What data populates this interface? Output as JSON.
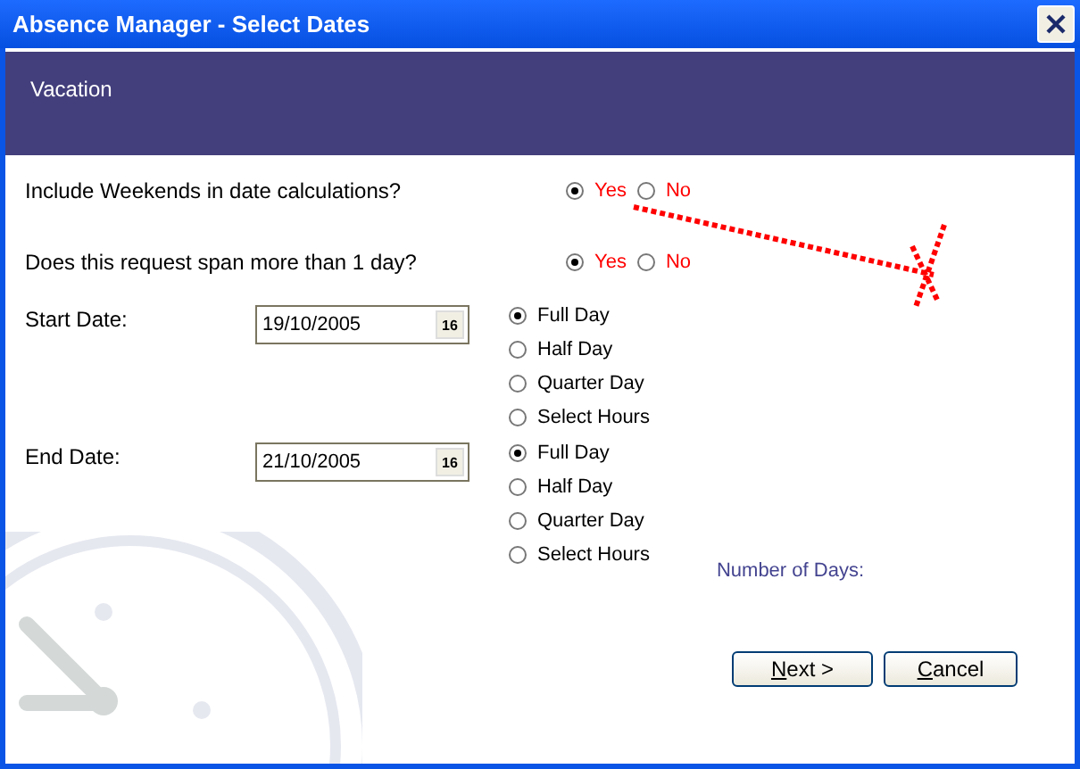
{
  "window": {
    "title": "Absence Manager - Select Dates"
  },
  "header": {
    "title": "Vacation"
  },
  "questions": [
    {
      "label": "Include Weekends in date calculations?",
      "options": [
        {
          "label": "Yes",
          "selected": true
        },
        {
          "label": "No",
          "selected": false
        }
      ]
    },
    {
      "label": "Does this request span more than 1 day?",
      "options": [
        {
          "label": "Yes",
          "selected": true
        },
        {
          "label": "No",
          "selected": false
        }
      ]
    }
  ],
  "dates": [
    {
      "label": "Start Date:",
      "value": "19/10/2005",
      "calendar_button": "16",
      "durations": [
        {
          "label": "Full Day",
          "selected": true
        },
        {
          "label": "Half Day",
          "selected": false
        },
        {
          "label": "Quarter Day",
          "selected": false
        },
        {
          "label": "Select Hours",
          "selected": false
        }
      ]
    },
    {
      "label": "End Date:",
      "value": "21/10/2005",
      "calendar_button": "16",
      "durations": [
        {
          "label": "Full Day",
          "selected": true
        },
        {
          "label": "Half Day",
          "selected": false
        },
        {
          "label": "Quarter Day",
          "selected": false
        },
        {
          "label": "Select Hours",
          "selected": false
        }
      ]
    }
  ],
  "number_of_days": {
    "label": "Number of Days:"
  },
  "buttons": [
    {
      "label": "Next >"
    },
    {
      "label": "Cancel"
    }
  ]
}
